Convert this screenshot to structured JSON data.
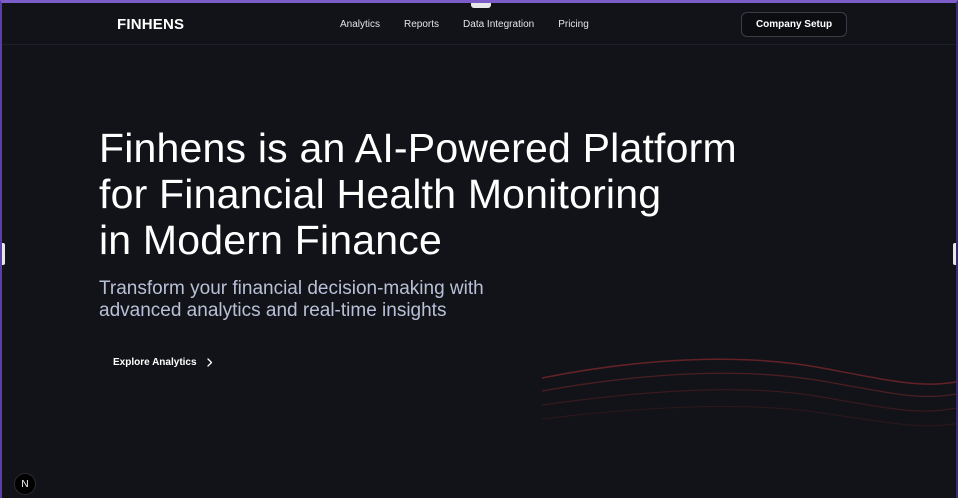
{
  "nav": {
    "logo": "FINHENS",
    "links": [
      "Analytics",
      "Reports",
      "Data Integration",
      "Pricing"
    ],
    "cta": "Company Setup"
  },
  "hero": {
    "title_lines": [
      "Finhens is an AI-Powered Platform",
      "for Financial Health Monitoring",
      "in Modern Finance"
    ],
    "subtitle_lines": [
      "Transform your financial decision-making with",
      "advanced analytics and real-time insights"
    ],
    "explore_label": "Explore Analytics"
  },
  "badge": {
    "label": "N"
  },
  "colors": {
    "background": "#111318",
    "accent_border": "#7c5cc8",
    "subtitle": "#b9c0d6",
    "wave": "#7a2a2e"
  }
}
